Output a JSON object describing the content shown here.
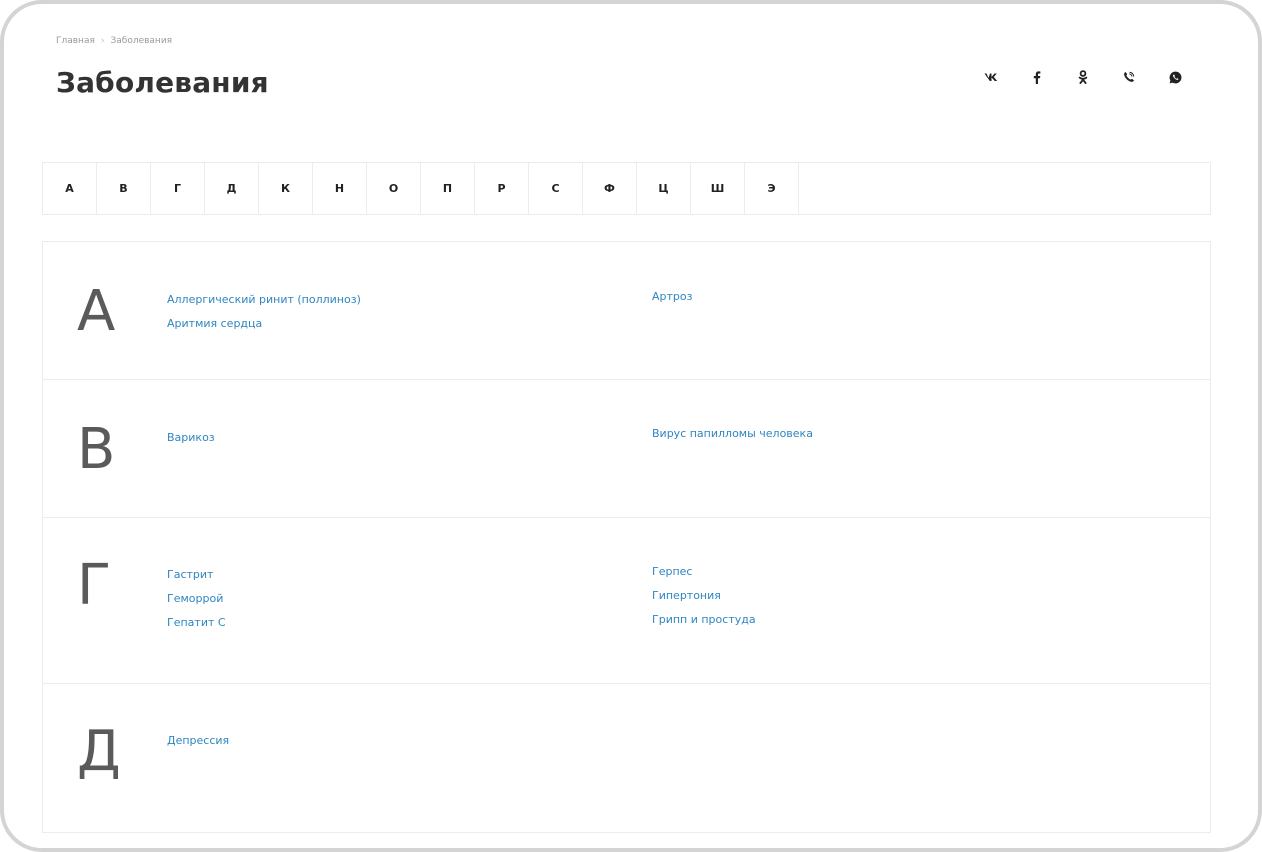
{
  "breadcrumb": {
    "home": "Главная",
    "separator": "›",
    "current": "Заболевания"
  },
  "page": {
    "title": "Заболевания"
  },
  "social": [
    {
      "name": "vk-icon",
      "glyph": "vk"
    },
    {
      "name": "facebook-icon",
      "glyph": "f"
    },
    {
      "name": "odnoklassniki-icon",
      "glyph": "ok"
    },
    {
      "name": "viber-icon",
      "glyph": "viber"
    },
    {
      "name": "whatsapp-icon",
      "glyph": "whatsapp"
    }
  ],
  "alphabet": [
    "А",
    "В",
    "Г",
    "Д",
    "К",
    "Н",
    "О",
    "П",
    "Р",
    "С",
    "Ф",
    "Ц",
    "Ш",
    "Э"
  ],
  "sections": [
    {
      "letter": "А",
      "left": [
        "Аллергический ринит (поллиноз)",
        "Аритмия сердца"
      ],
      "right": [
        "Артроз"
      ]
    },
    {
      "letter": "В",
      "left": [
        "Варикоз"
      ],
      "right": [
        "Вирус папилломы человека"
      ]
    },
    {
      "letter": "Г",
      "left": [
        "Гастрит",
        "Геморрой",
        "Гепатит С"
      ],
      "right": [
        "Герпес",
        "Гипертония",
        "Грипп и простуда"
      ]
    },
    {
      "letter": "Д",
      "left": [
        "Депрессия"
      ],
      "right": []
    }
  ],
  "colors": {
    "link": "#2e86c1",
    "border": "#ececec",
    "letter": "#5a5a5a"
  }
}
